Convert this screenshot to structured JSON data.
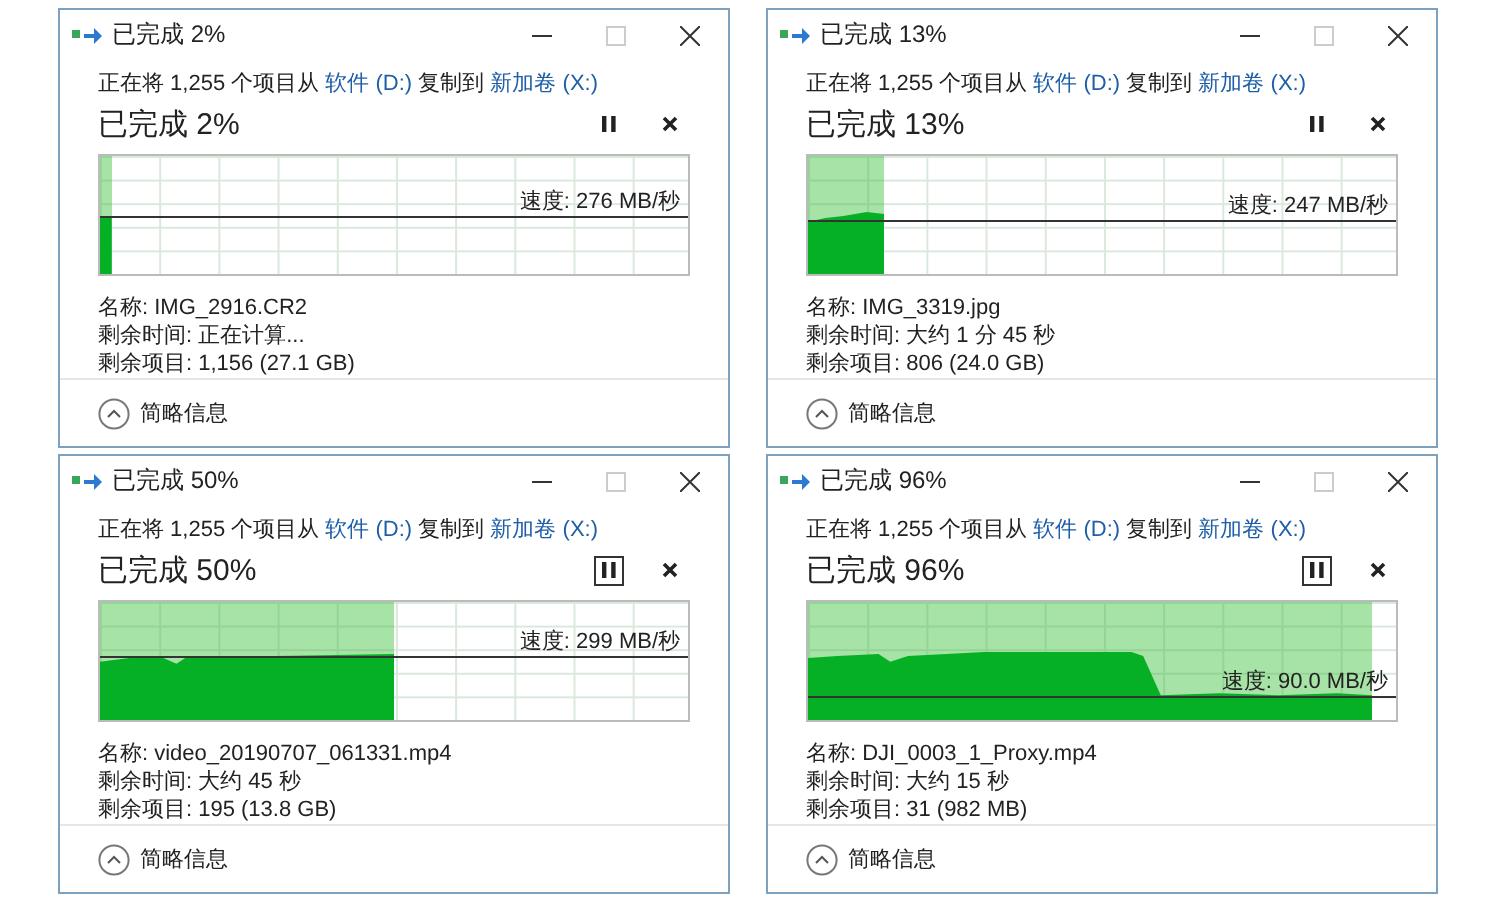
{
  "dialogs": [
    {
      "title": "已完成 2%",
      "description": {
        "prefix": "正在将 1,255 个项目从",
        "source": "软件 (D:)",
        "middle": "复制到",
        "destination": "新加卷 (X:)"
      },
      "heading": "已完成 2%",
      "pause_focused": false,
      "level": 0.02,
      "speed": "速度: 276 MB/秒",
      "details": [
        "名称: IMG_2916.CR2",
        "剩余时间: 正在计算...",
        "剩余项目: 1,156 (27.1 GB)"
      ],
      "footer": "简略信息"
    },
    {
      "title": "已完成 13%",
      "description": {
        "prefix": "正在将 1,255 个项目从",
        "source": "软件 (D:)",
        "middle": "复制到",
        "destination": "新加卷 (X:)"
      },
      "heading": "已完成 13%",
      "pause_focused": false,
      "level": 0.13,
      "speed": "速度: 247 MB/秒",
      "details": [
        "名称: IMG_3319.jpg",
        "剩余时间: 大约 1 分 45 秒",
        "剩余项目: 806 (24.0 GB)"
      ],
      "footer": "简略信息"
    },
    {
      "title": "已完成 50%",
      "description": {
        "prefix": "正在将 1,255 个项目从",
        "source": "软件 (D:)",
        "middle": "复制到",
        "destination": "新加卷 (X:)"
      },
      "heading": "已完成 50%",
      "pause_focused": true,
      "level": 0.5,
      "speed": "速度: 299 MB/秒",
      "details": [
        "名称: video_20190707_061331.mp4",
        "剩余时间: 大约 45 秒",
        "剩余项目: 195 (13.8 GB)"
      ],
      "footer": "简略信息"
    },
    {
      "title": "已完成 96%",
      "description": {
        "prefix": "正在将 1,255 个项目从",
        "source": "软件 (D:)",
        "middle": "复制到",
        "destination": "新加卷 (X:)"
      },
      "heading": "已完成 96%",
      "pause_focused": true,
      "level": 0.96,
      "speed": "速度: 90.0 MB/秒",
      "details": [
        "名称: DJI_0003_1_Proxy.mp4",
        "剩余时间: 大约 15 秒",
        "剩余项目: 31 (982 MB)"
      ],
      "footer": "简略信息"
    }
  ]
}
